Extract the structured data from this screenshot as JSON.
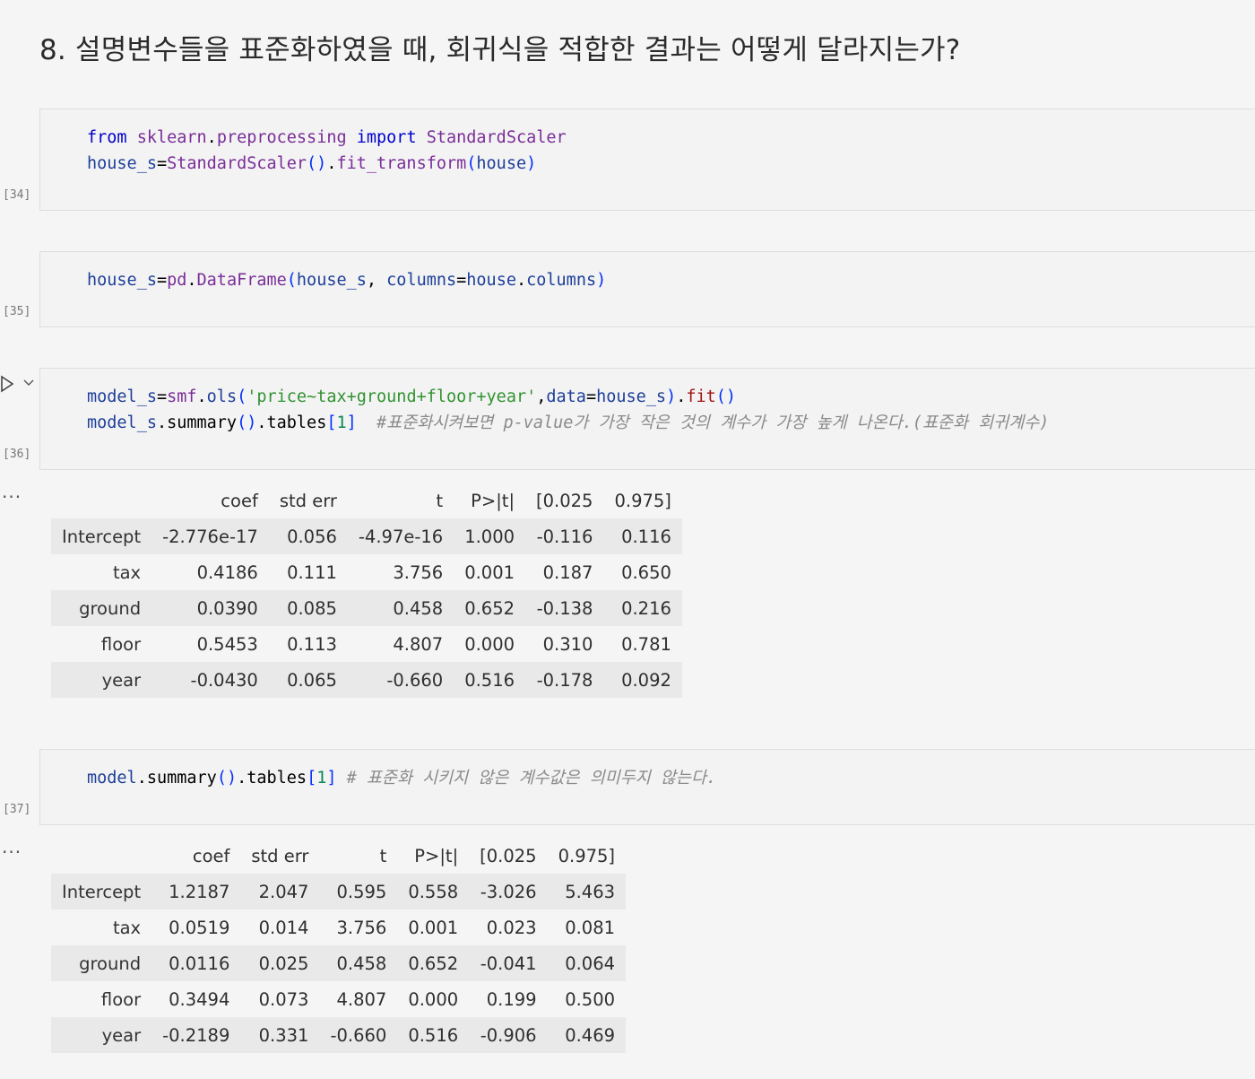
{
  "heading": "8. 설명변수들을 표준화하였을 때, 회귀식을 적합한 결과는 어떻게 달라지는가?",
  "cells": [
    {
      "exec": "[34]"
    },
    {
      "exec": "[35]"
    },
    {
      "exec": "[36]"
    },
    {
      "exec": "[37]"
    }
  ],
  "output_more": "...",
  "table1": {
    "headers": [
      "",
      "coef",
      "std err",
      "t",
      "P>|t|",
      "[0.025",
      "0.975]"
    ],
    "rows": [
      [
        "Intercept",
        "-2.776e-17",
        "0.056",
        "-4.97e-16",
        "1.000",
        "-0.116",
        "0.116"
      ],
      [
        "tax",
        "0.4186",
        "0.111",
        "3.756",
        "0.001",
        "0.187",
        "0.650"
      ],
      [
        "ground",
        "0.0390",
        "0.085",
        "0.458",
        "0.652",
        "-0.138",
        "0.216"
      ],
      [
        "floor",
        "0.5453",
        "0.113",
        "4.807",
        "0.000",
        "0.310",
        "0.781"
      ],
      [
        "year",
        "-0.0430",
        "0.065",
        "-0.660",
        "0.516",
        "-0.178",
        "0.092"
      ]
    ]
  },
  "table2": {
    "headers": [
      "",
      "coef",
      "std err",
      "t",
      "P>|t|",
      "[0.025",
      "0.975]"
    ],
    "rows": [
      [
        "Intercept",
        "1.2187",
        "2.047",
        "0.595",
        "0.558",
        "-3.026",
        "5.463"
      ],
      [
        "tax",
        "0.0519",
        "0.014",
        "3.756",
        "0.001",
        "0.023",
        "0.081"
      ],
      [
        "ground",
        "0.0116",
        "0.025",
        "0.458",
        "0.652",
        "-0.041",
        "0.064"
      ],
      [
        "floor",
        "0.3494",
        "0.073",
        "4.807",
        "0.000",
        "0.199",
        "0.500"
      ],
      [
        "year",
        "-0.2189",
        "0.331",
        "-0.660",
        "0.516",
        "-0.906",
        "0.469"
      ]
    ]
  },
  "code": {
    "c34_l1": [
      "from",
      "sklearn",
      ".",
      "preprocessing",
      "import",
      "StandardScaler"
    ],
    "c34_l2": [
      "house_s",
      "=",
      "StandardScaler",
      "()",
      ".",
      "fit_transform",
      "(",
      "house",
      ")"
    ],
    "c35_l1": [
      "house_s",
      "=",
      "pd",
      ".",
      "DataFrame",
      "(",
      "house_s",
      ",",
      "columns",
      "=",
      "house",
      ".",
      "columns",
      ")"
    ],
    "c36_l1": [
      "model_s",
      "=",
      "smf",
      ".",
      "ols",
      "(",
      "'price~tax+ground+floor+year'",
      ",",
      "data",
      "=",
      "house_s",
      ")",
      ".",
      "fit",
      "()"
    ],
    "c36_l2": [
      "model_s",
      ".",
      "summary",
      "()",
      ".",
      "tables",
      "[",
      "1",
      "]",
      "#표준화시켜보면 p-value가 가장 작은 것의 계수가 가장 높게 나온다.(표준화 회귀계수)"
    ],
    "c37_l1": [
      "model",
      ".",
      "summary",
      "()",
      ".",
      "tables",
      "[",
      "1",
      "]",
      "# 표준화 시키지 않은 계수값은 의미두지 않는다."
    ]
  }
}
